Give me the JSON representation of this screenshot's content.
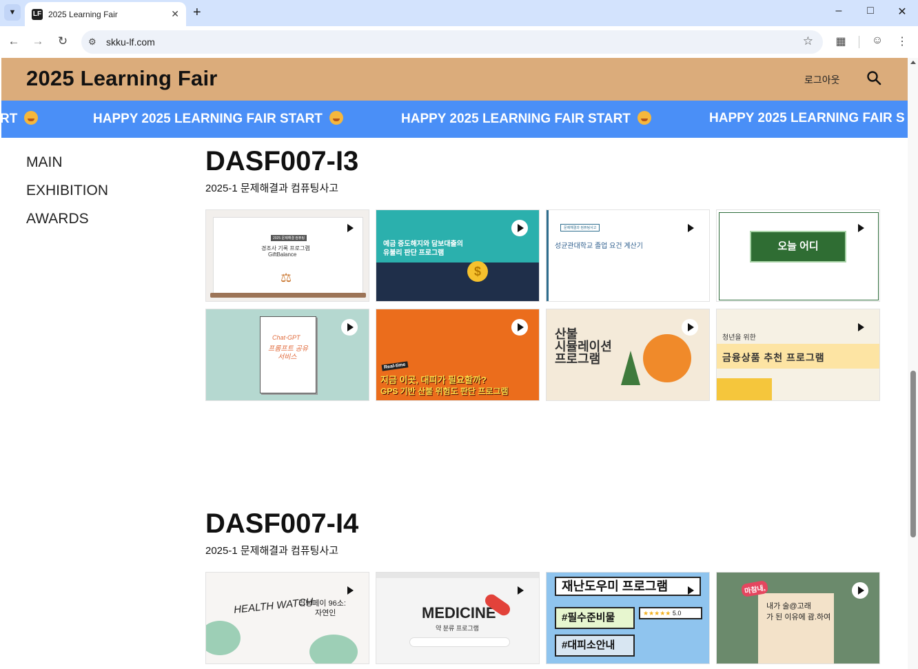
{
  "browser": {
    "tab_title": "2025 Learning Fair",
    "url": "skku-lf.com"
  },
  "site": {
    "title": "2025 Learning Fair",
    "logout_label": "로그아웃",
    "marquee_text": "HAPPY 2025 LEARNING FAIR START",
    "marquee_partial_left": "RT",
    "marquee_partial_right": "HAPPY 2025 LEARNING FAIR S"
  },
  "nav": {
    "items": [
      {
        "label": "MAIN"
      },
      {
        "label": "EXHIBITION"
      },
      {
        "label": "AWARDS"
      }
    ]
  },
  "sections": [
    {
      "title": "DASF007-I3",
      "subtitle": "2025-1 문제해결과 컴퓨팅사고",
      "cards": [
        {
          "name": "giftbalance",
          "heading": "경조사 기록 프로그램",
          "sub": "GiftBalance",
          "tag": "2025 문제해결 컴퓨팅"
        },
        {
          "name": "deposit-loan",
          "heading": "예금 중도해지와 담보대출의",
          "heading2": "유불리 판단 프로그램"
        },
        {
          "name": "graduation",
          "heading": "성균관대학교 졸업 요건 계산기",
          "tag": "문제해결과 컴퓨팅사고"
        },
        {
          "name": "where-today",
          "heading": "오늘 어디"
        },
        {
          "name": "chat-gpt",
          "heading": "Chat-GPT",
          "heading2": "프롬프트 공유",
          "heading3": "서비스"
        },
        {
          "name": "evacuation",
          "heading": "지금 이곳, 대피가 필요할까?",
          "heading2": "GPS 기반 산불 위험도 판단 프로그램",
          "tag": "Real-time"
        },
        {
          "name": "wildfire-sim",
          "heading": "산불",
          "heading2": "시뮬레이션",
          "heading3": "프로그램"
        },
        {
          "name": "finance",
          "heading": "청년을 위한",
          "heading2": "금융상품 추천 프로그램"
        }
      ]
    },
    {
      "title": "DASF007-I4",
      "subtitle": "2025-1 문제해결과 컴퓨팅사고",
      "cards": [
        {
          "name": "health-watch",
          "heading": "HEALTH WATCH",
          "heading2": "러닝페이 96소:",
          "heading3": "자연인"
        },
        {
          "name": "medicine",
          "heading": "MEDICINE",
          "heading2": "약 분류 프로그램"
        },
        {
          "name": "disaster-helper",
          "heading": "재난도우미 프로그램",
          "heading2": "#필수준비물",
          "heading3": "#대피소안내",
          "rating": "5.0"
        },
        {
          "name": "hangover",
          "heading": "마참내,",
          "heading2": "내가 술@고래",
          "heading3": "가 된 이유에 괌.하여"
        }
      ]
    }
  ],
  "colors": {
    "header_bg": "#dbac7b",
    "marquee_bg": "#4a8ff7",
    "tabstrip_bg": "#d3e3fd"
  }
}
